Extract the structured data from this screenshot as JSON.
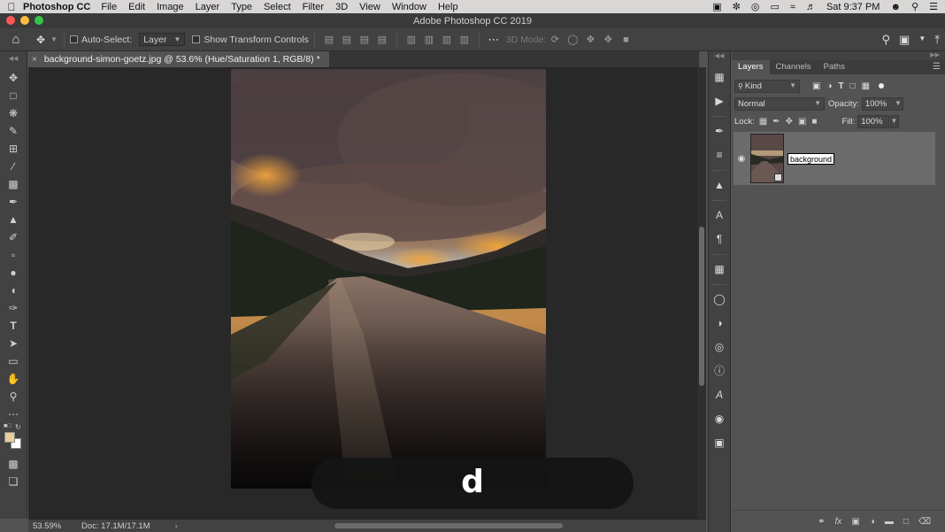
{
  "menubar": {
    "app_name": "Photoshop CC",
    "menus": [
      "File",
      "Edit",
      "Image",
      "Layer",
      "Type",
      "Select",
      "Filter",
      "3D",
      "View",
      "Window",
      "Help"
    ],
    "clock": "Sat 9:37 PM"
  },
  "window": {
    "title": "Adobe Photoshop CC 2019"
  },
  "options": {
    "auto_select_label": "Auto-Select:",
    "auto_select_target": "Layer",
    "show_transform_label": "Show Transform Controls",
    "mode_3d_label": "3D Mode:"
  },
  "document": {
    "tab_title": "background-simon-goetz.jpg @ 53.6% (Hue/Saturation 1, RGB/8) *"
  },
  "caption": {
    "text": "d"
  },
  "status": {
    "zoom": "53.59%",
    "doc_size": "Doc: 17.1M/17.1M"
  },
  "layers_panel": {
    "tabs": [
      "Layers",
      "Channels",
      "Paths"
    ],
    "filter_kind": "Kind",
    "blend_mode": "Normal",
    "opacity_label": "Opacity:",
    "opacity_value": "100%",
    "lock_label": "Lock:",
    "fill_label": "Fill:",
    "fill_value": "100%",
    "layers": [
      {
        "name": "background",
        "visible": true,
        "selected": true
      }
    ]
  },
  "colors": {
    "foreground": "#e7cf9b",
    "background": "#ffffff"
  }
}
